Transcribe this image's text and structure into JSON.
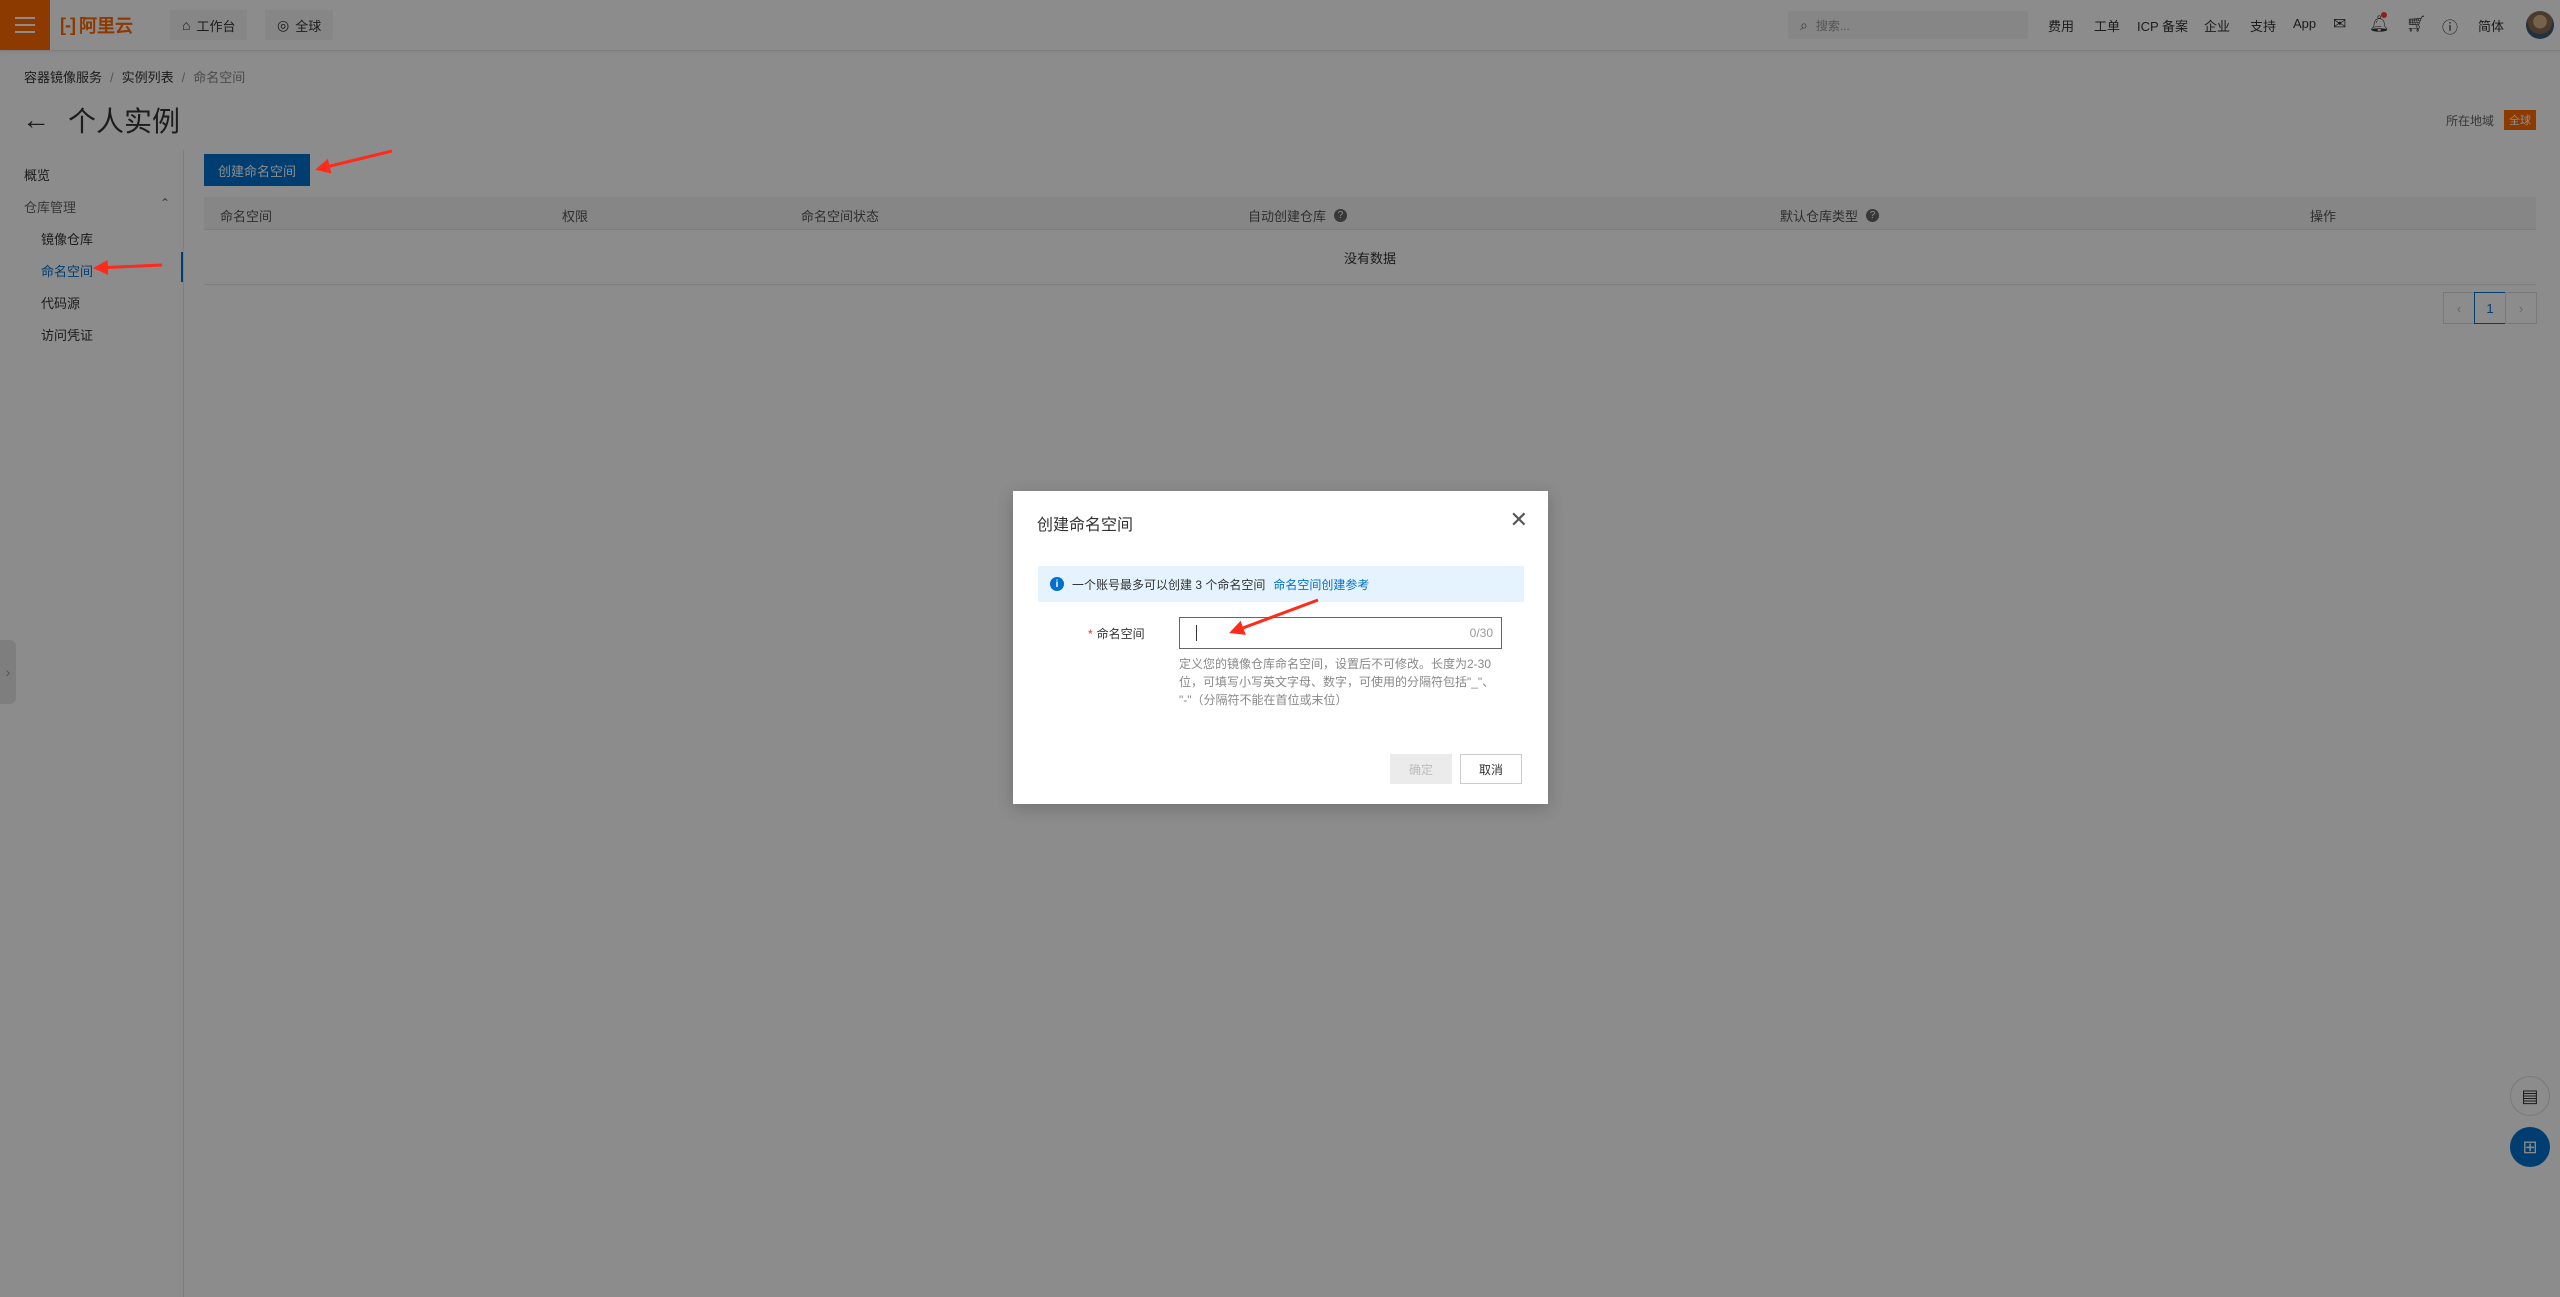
{
  "topbar": {
    "logo_text": "阿里云",
    "workbench": "工作台",
    "region": "全球",
    "search_placeholder": "搜索...",
    "links": [
      "费用",
      "工单",
      "ICP 备案",
      "企业",
      "支持",
      "App"
    ],
    "lang": "简体"
  },
  "breadcrumb": [
    "容器镜像服务",
    "实例列表",
    "命名空间"
  ],
  "page_title": "个人实例",
  "region_label": "所在地域",
  "region_value": "全球",
  "sidebar": {
    "overview": "概览",
    "group": "仓库管理",
    "items": [
      "镜像仓库",
      "命名空间",
      "代码源",
      "访问凭证"
    ],
    "active_item": "命名空间"
  },
  "main": {
    "create_button": "创建命名空间",
    "columns": [
      "命名空间",
      "权限",
      "命名空间状态",
      "自动创建仓库",
      "默认仓库类型",
      "操作"
    ],
    "empty_text": "没有数据",
    "page": "1"
  },
  "dialog": {
    "title": "创建命名空间",
    "notice": "一个账号最多可以创建 3 个命名空间",
    "notice_link": "命名空间创建参考",
    "field_label": "命名空间",
    "input_value": "",
    "counter": "0/30",
    "help_line1": "定义您的镜像仓库命名空间，设置后不可修改。长度为2-30",
    "help_line2": "位，可填写小写英文字母、数字，可使用的分隔符包括\"_\"、",
    "help_line3": "\"-\"（分隔符不能在首位或末位）",
    "ok": "确定",
    "cancel": "取消"
  },
  "colors": {
    "brand": "#ff6a00",
    "primary": "#0070cc",
    "annotation": "#ff2a1a"
  }
}
